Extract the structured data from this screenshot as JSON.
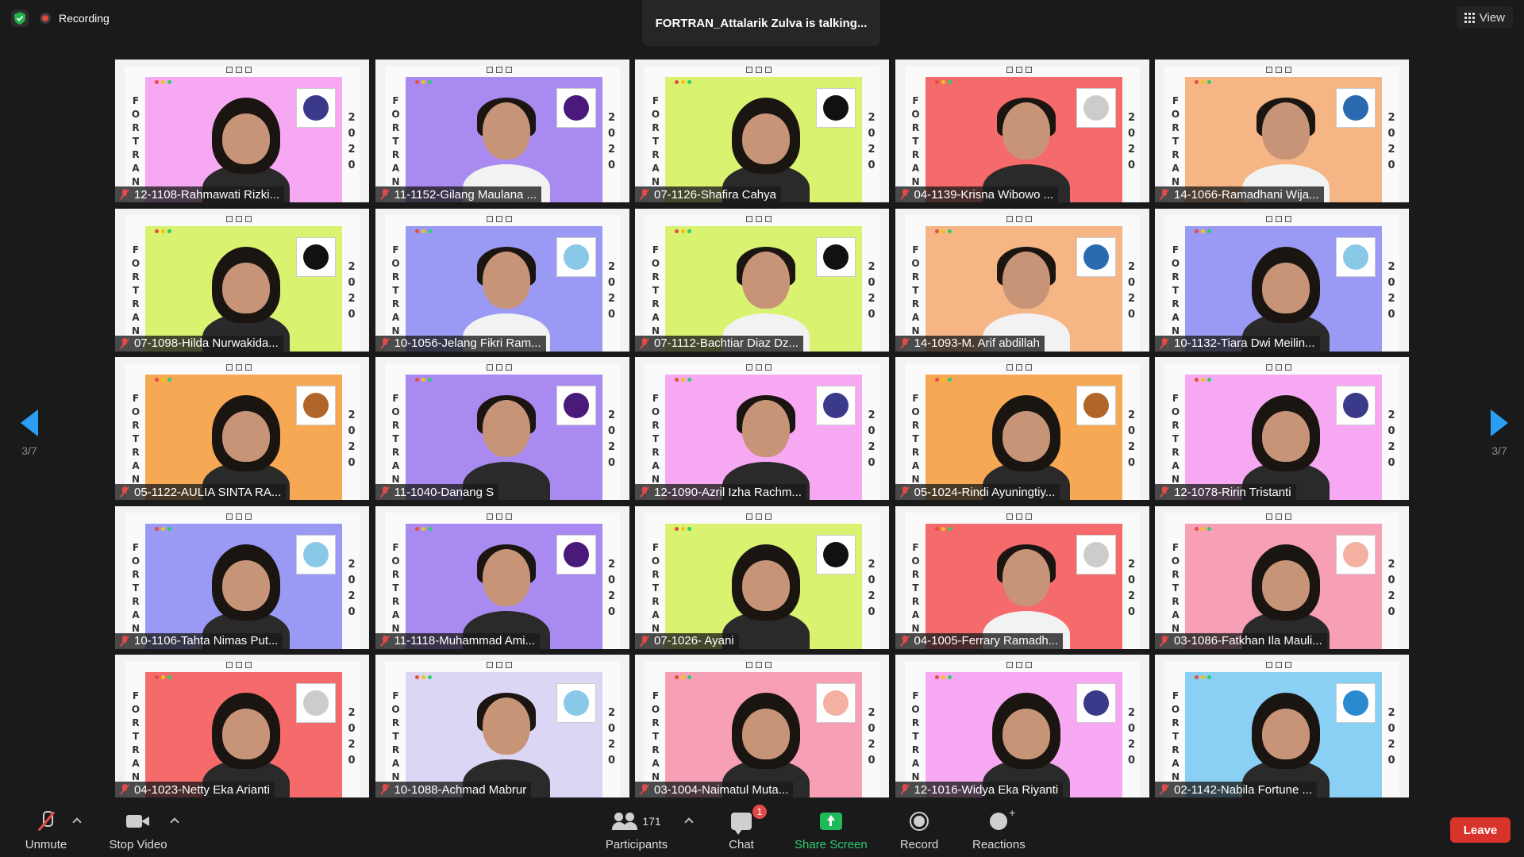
{
  "header": {
    "recording_label": "Recording",
    "talking_banner": "FORTRAN_Attalarik Zulva is talking...",
    "view_label": "View"
  },
  "pagination": {
    "left": "3/7",
    "right": "3/7"
  },
  "tile_text": {
    "left_vertical": "F\nO\nR\nT\nR\nA\nN",
    "right_vertical": "2\n0\n2\n0"
  },
  "participants": [
    {
      "name": "12-1108-Rahmawati Rizki...",
      "bg": "#f7a8f2",
      "logo": "#3b3a8a",
      "style": "hijab"
    },
    {
      "name": "11-1152-Gilang Maulana ...",
      "bg": "#a98af0",
      "logo": "#4a1a7a",
      "style": "white"
    },
    {
      "name": "07-1126-Shafira Cahya",
      "bg": "#d9f270",
      "logo": "#111111",
      "style": "hijab"
    },
    {
      "name": "04-1139-Krisna Wibowo ...",
      "bg": "#f56a6a",
      "logo": "#cccccc",
      "style": "plain"
    },
    {
      "name": "14-1066-Ramadhani Wija...",
      "bg": "#f5b585",
      "logo": "#2a6ab0",
      "style": "white"
    },
    {
      "name": "07-1098-Hilda Nurwakida...",
      "bg": "#d9f270",
      "logo": "#111111",
      "style": "hijab"
    },
    {
      "name": "10-1056-Jelang Fikri Ram...",
      "bg": "#9a9af5",
      "logo": "#8ac8e8",
      "style": "white"
    },
    {
      "name": "07-1112-Bachtiar Diaz Dz...",
      "bg": "#d9f270",
      "logo": "#111111",
      "style": "white"
    },
    {
      "name": "14-1093-M. Arif abdillah",
      "bg": "#f5b585",
      "logo": "#2a6ab0",
      "style": "white"
    },
    {
      "name": "10-1132-Tiara Dwi Meilin...",
      "bg": "#9a9af5",
      "logo": "#8ac8e8",
      "style": "hijab"
    },
    {
      "name": "05-1122-AULIA SINTA RA...",
      "bg": "#f7a855",
      "logo": "#b0652a",
      "style": "hijab"
    },
    {
      "name": "11-1040-Danang S",
      "bg": "#a98af0",
      "logo": "#4a1a7a",
      "style": "plain"
    },
    {
      "name": "12-1090-Azril Izha Rachm...",
      "bg": "#f7a8f2",
      "logo": "#3b3a8a",
      "style": "plain"
    },
    {
      "name": "05-1024-Rindi Ayuningtiy...",
      "bg": "#f7a855",
      "logo": "#b0652a",
      "style": "hijab"
    },
    {
      "name": "12-1078-Ririn Tristanti",
      "bg": "#f7a8f2",
      "logo": "#3b3a8a",
      "style": "hijab"
    },
    {
      "name": "10-1106-Tahta Nimas Put...",
      "bg": "#9a9af5",
      "logo": "#8ac8e8",
      "style": "hijab"
    },
    {
      "name": "11-1118-Muhammad Ami...",
      "bg": "#a98af0",
      "logo": "#4a1a7a",
      "style": "plain"
    },
    {
      "name": "07-1026- Ayani",
      "bg": "#d9f270",
      "logo": "#111111",
      "style": "hijab"
    },
    {
      "name": "04-1005-Ferrary Ramadh...",
      "bg": "#f56a6a",
      "logo": "#cccccc",
      "style": "white"
    },
    {
      "name": "03-1086-Fatkhan Ila Mauli...",
      "bg": "#f7a0b5",
      "logo": "#f4b0a0",
      "style": "hijab"
    },
    {
      "name": "04-1023-Netty Eka Arianti",
      "bg": "#f56a6a",
      "logo": "#cccccc",
      "style": "hijab"
    },
    {
      "name": "10-1088-Achmad Mabrur",
      "bg": "#dcd6f5",
      "logo": "#8ac8e8",
      "style": "plain"
    },
    {
      "name": "03-1004-Naimatul Muta...",
      "bg": "#f7a0b5",
      "logo": "#f4b0a0",
      "style": "hijab"
    },
    {
      "name": "12-1016-Widya Eka Riyanti",
      "bg": "#f7a8f2",
      "logo": "#3b3a8a",
      "style": "hijab"
    },
    {
      "name": "02-1142-Nabila Fortune ...",
      "bg": "#8ad0f5",
      "logo": "#2a8ad0",
      "style": "hijab"
    }
  ],
  "toolbar": {
    "unmute": "Unmute",
    "stop_video": "Stop Video",
    "participants_label": "Participants",
    "participants_count": "171",
    "chat": "Chat",
    "chat_badge": "1",
    "share_screen": "Share Screen",
    "record": "Record",
    "reactions": "Reactions",
    "leave": "Leave"
  },
  "colors": {
    "background": "#1a1a1a",
    "accent_blue": "#2b9ef3",
    "share_green": "#1fba5a",
    "leave_red": "#d9342b",
    "muted_red": "#e24a4a"
  }
}
